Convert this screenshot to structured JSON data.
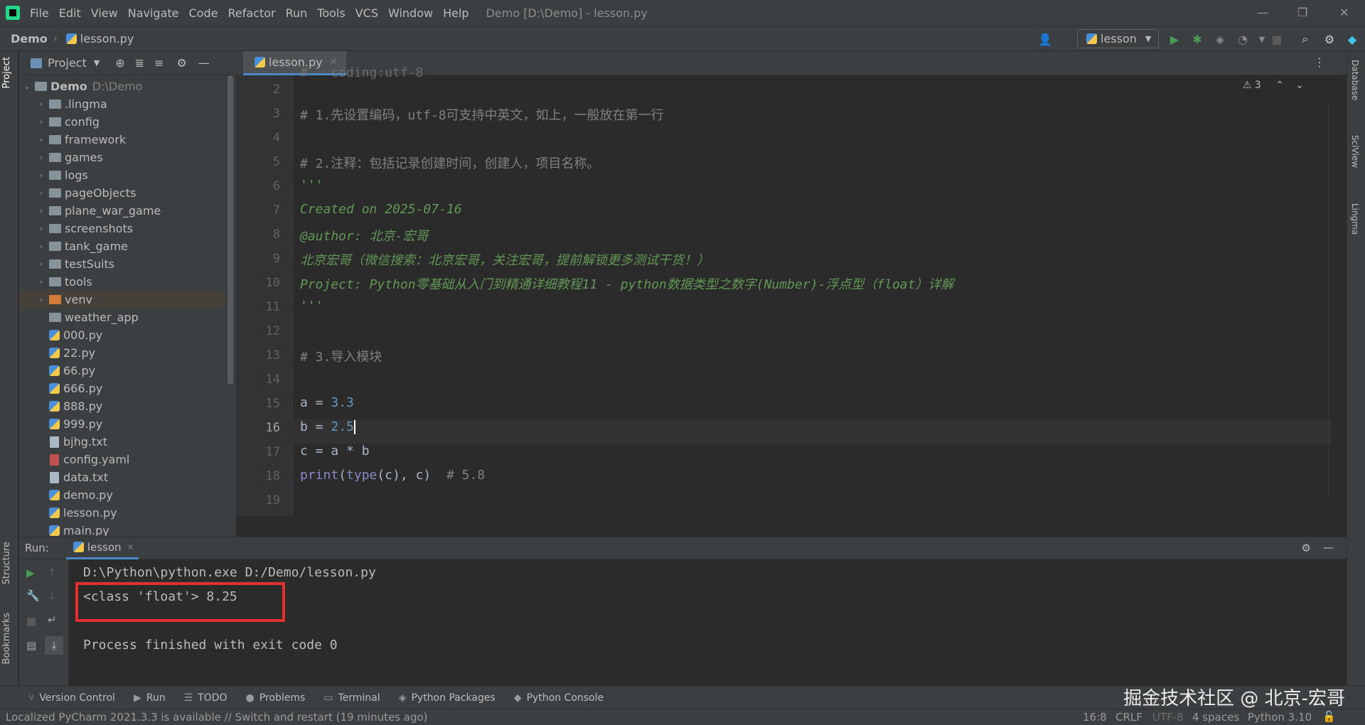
{
  "menubar": {
    "items": [
      "File",
      "Edit",
      "View",
      "Navigate",
      "Code",
      "Refactor",
      "Run",
      "Tools",
      "VCS",
      "Window",
      "Help"
    ],
    "window_title": "Demo [D:\\Demo] - lesson.py"
  },
  "navbar": {
    "breadcrumb_project": "Demo",
    "breadcrumb_file": "lesson.py",
    "run_config": "lesson"
  },
  "left_strip": {
    "project": "Project",
    "structure": "Structure",
    "bookmarks": "Bookmarks"
  },
  "right_strip": {
    "database": "Database",
    "sciview": "SciView",
    "lingma": "Lingma"
  },
  "project_panel": {
    "title": "Project",
    "root": {
      "name": "Demo",
      "path": "D:\\Demo"
    },
    "items": [
      {
        "label": ".lingma",
        "kind": "folder"
      },
      {
        "label": "config",
        "kind": "folder"
      },
      {
        "label": "framework",
        "kind": "folder"
      },
      {
        "label": "games",
        "kind": "folder"
      },
      {
        "label": "logs",
        "kind": "folder"
      },
      {
        "label": "pageObjects",
        "kind": "folder"
      },
      {
        "label": "plane_war_game",
        "kind": "folder"
      },
      {
        "label": "screenshots",
        "kind": "folder"
      },
      {
        "label": "tank_game",
        "kind": "folder"
      },
      {
        "label": "testSuits",
        "kind": "folder"
      },
      {
        "label": "tools",
        "kind": "folder"
      },
      {
        "label": "venv",
        "kind": "folder-excluded"
      },
      {
        "label": "weather_app",
        "kind": "folder-noarrow"
      },
      {
        "label": "000.py",
        "kind": "py"
      },
      {
        "label": "22.py",
        "kind": "py"
      },
      {
        "label": "66.py",
        "kind": "py"
      },
      {
        "label": "666.py",
        "kind": "py"
      },
      {
        "label": "888.py",
        "kind": "py"
      },
      {
        "label": "999.py",
        "kind": "py"
      },
      {
        "label": "bjhg.txt",
        "kind": "txt"
      },
      {
        "label": "config.yaml",
        "kind": "yml"
      },
      {
        "label": "data.txt",
        "kind": "txt"
      },
      {
        "label": "demo.py",
        "kind": "py"
      },
      {
        "label": "lesson.py",
        "kind": "py"
      },
      {
        "label": "main.py",
        "kind": "py"
      }
    ]
  },
  "editor": {
    "tab_label": "lesson.py",
    "warnings": "3",
    "first_partial": "#   coding:utf-8",
    "lines": [
      {
        "n": "2",
        "html": ""
      },
      {
        "n": "3",
        "html": "<span class='cm'># 1.先设置编码，utf-8可支持中英文，如上，一般放在第一行</span>"
      },
      {
        "n": "4",
        "html": ""
      },
      {
        "n": "5",
        "html": "<span class='cm'># 2.注释：包括记录创建时间，创建人，项目名称。</span>"
      },
      {
        "n": "6",
        "html": "<span class='ds'>'''</span>"
      },
      {
        "n": "7",
        "html": "<span class='ds'>Created on 2025-07-16</span>"
      },
      {
        "n": "8",
        "html": "<span class='ds'>@author: 北京-宏哥</span>"
      },
      {
        "n": "9",
        "html": "<span class='ds'>北京宏哥（微信搜索：北京宏哥，关注宏哥，提前解锁更多测试干货！）</span>"
      },
      {
        "n": "10",
        "html": "<span class='ds'>Project: Python零基础从入门到精通详细教程11 - python数据类型之数字(Number)-浮点型（float）详解</span>"
      },
      {
        "n": "11",
        "html": "<span class='ds'>'''</span>"
      },
      {
        "n": "12",
        "html": ""
      },
      {
        "n": "13",
        "html": "<span class='cm'># 3.导入模块</span>"
      },
      {
        "n": "14",
        "html": ""
      },
      {
        "n": "15",
        "html": "a = <span class='num'>3.3</span>"
      },
      {
        "n": "16",
        "html": "b = <span class='num'>2.5</span><span class='caret'></span>"
      },
      {
        "n": "17",
        "html": "c = a * b"
      },
      {
        "n": "18",
        "html": "<span class='fn'>print</span>(<span class='fn'>type</span>(c), c)  <span class='cm'># 5.8</span>"
      },
      {
        "n": "19",
        "html": ""
      }
    ]
  },
  "run": {
    "label": "Run:",
    "tab": "lesson",
    "lines": [
      "D:\\Python\\python.exe D:/Demo/lesson.py",
      "<class 'float'> 8.25",
      "",
      "Process finished with exit code 0"
    ]
  },
  "bottom_tabs": [
    "Version Control",
    "Run",
    "TODO",
    "Problems",
    "Terminal",
    "Python Packages",
    "Python Console"
  ],
  "status": {
    "message": "Localized PyCharm 2021.3.3 is available // Switch and restart (19 minutes ago)",
    "position": "16:8",
    "line_sep": "CRLF",
    "encoding": "UTF-8",
    "indent": "4 spaces",
    "interpreter": "Python 3.10"
  },
  "watermark": "掘金技术社区 @ 北京-宏哥",
  "colors": {
    "accent": "#4a88c7",
    "highlight_box": "#e03030",
    "run_green": "#499c54"
  }
}
